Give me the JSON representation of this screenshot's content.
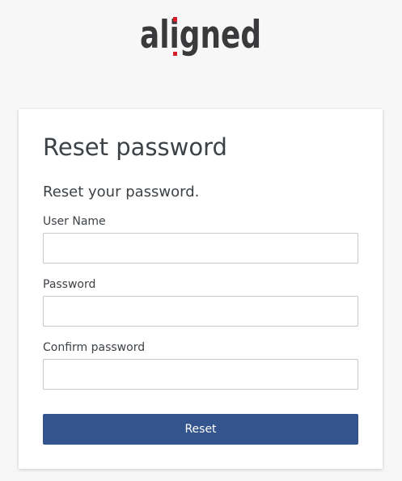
{
  "brand": {
    "logo_text": "aligned",
    "accent_color": "#d31f2a",
    "text_color": "#3a3a3c"
  },
  "form": {
    "title": "Reset password",
    "subtitle": "Reset your password.",
    "fields": {
      "username": {
        "label": "User Name",
        "value": "",
        "placeholder": ""
      },
      "password": {
        "label": "Password",
        "value": "",
        "placeholder": ""
      },
      "confirm_password": {
        "label": "Confirm password",
        "value": "",
        "placeholder": ""
      }
    },
    "submit_label": "Reset",
    "button_color": "#34548d"
  }
}
